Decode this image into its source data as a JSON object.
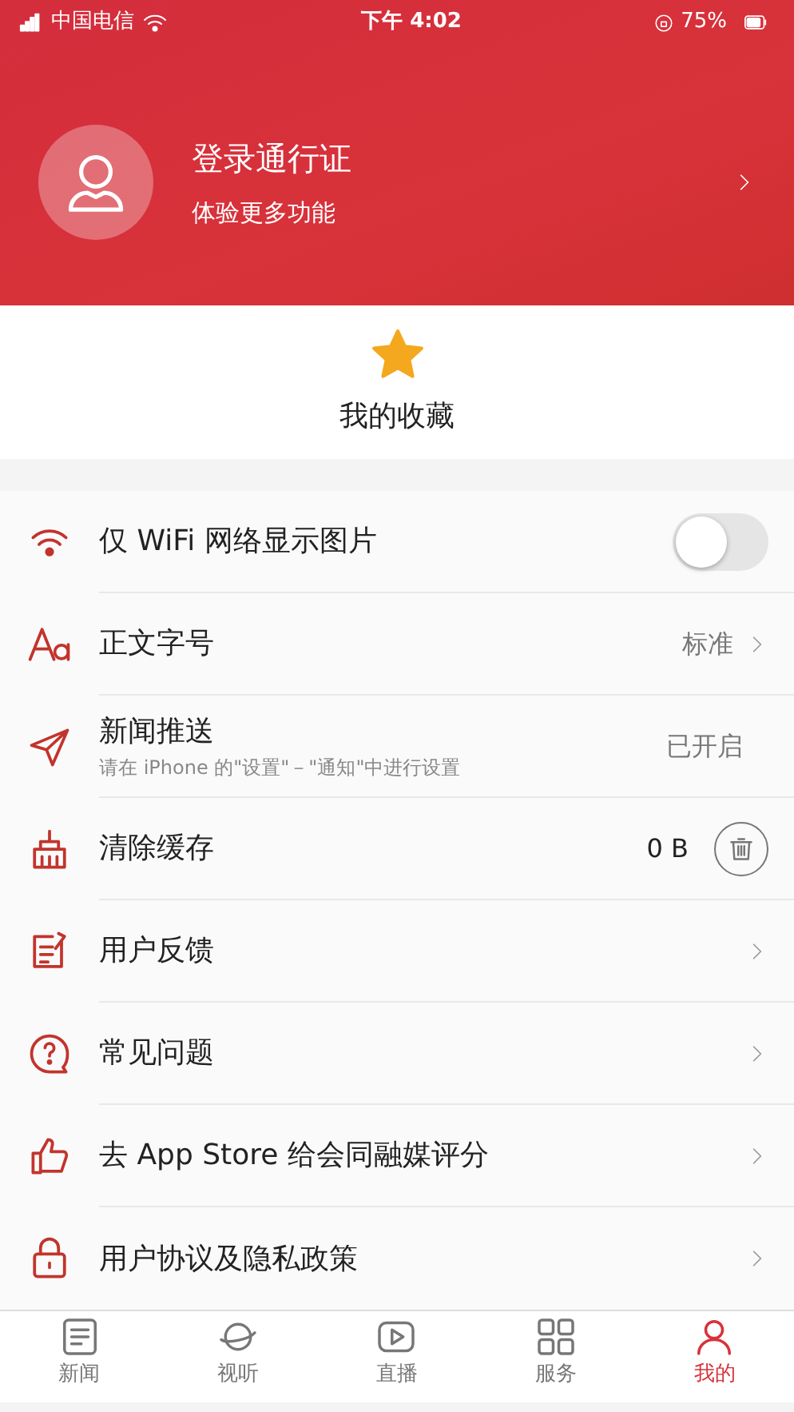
{
  "status_bar": {
    "carrier": "中国电信",
    "time": "下午 4:02",
    "battery": "75%"
  },
  "profile": {
    "title": "登录通行证",
    "subtitle": "体验更多功能"
  },
  "favorites": {
    "label": "我的收藏"
  },
  "settings": [
    {
      "kind": "toggle",
      "label": "仅 WiFi 网络显示图片",
      "on": false
    },
    {
      "kind": "value_link",
      "label": "正文字号",
      "value": "标准"
    },
    {
      "kind": "value",
      "label": "新闻推送",
      "note": "请在 iPhone 的\"设置\"－\"通知\"中进行设置",
      "value": "已开启"
    },
    {
      "kind": "cache",
      "label": "清除缓存",
      "value": "0 B"
    },
    {
      "kind": "link",
      "label": "用户反馈"
    },
    {
      "kind": "link",
      "label": "常见问题"
    },
    {
      "kind": "link",
      "label": "去 App Store 给会同融媒评分"
    },
    {
      "kind": "link",
      "label": "用户协议及隐私政策"
    }
  ],
  "tabs": [
    {
      "label": "新闻",
      "selected": false
    },
    {
      "label": "视听",
      "selected": false
    },
    {
      "label": "直播",
      "selected": false
    },
    {
      "label": "服务",
      "selected": false
    },
    {
      "label": "我的",
      "selected": true
    }
  ]
}
